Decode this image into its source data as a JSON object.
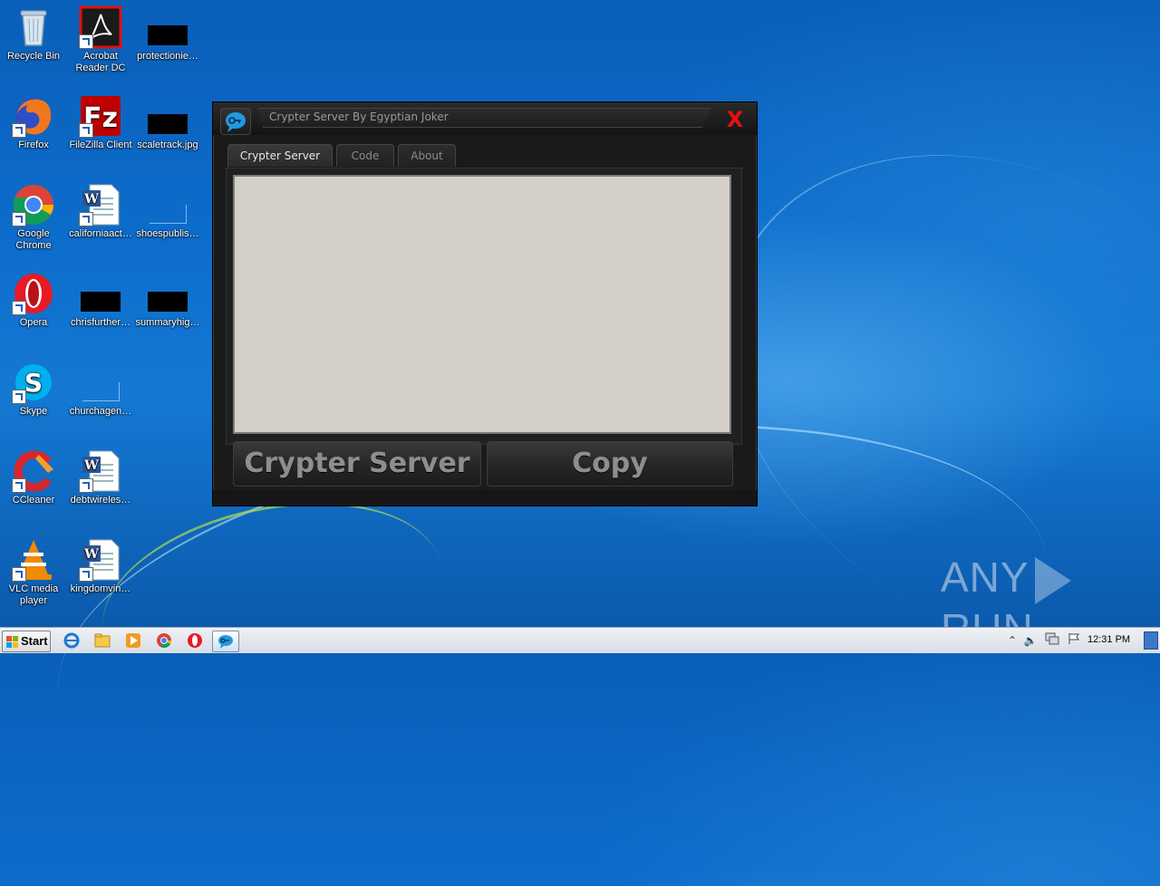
{
  "desktop": {
    "icons": [
      {
        "label": "Recycle Bin",
        "icon": "recycle-bin-icon"
      },
      {
        "label": "Acrobat Reader DC",
        "icon": "acrobat-reader-icon"
      },
      {
        "label": "protectionie…",
        "icon": "redacted-file-icon"
      },
      {
        "label": "Firefox",
        "icon": "firefox-icon"
      },
      {
        "label": "FileZilla Client",
        "icon": "filezilla-icon"
      },
      {
        "label": "scaletrack.jpg",
        "icon": "redacted-file-icon"
      },
      {
        "label": "Google Chrome",
        "icon": "chrome-icon"
      },
      {
        "label": "californiaact…",
        "icon": "word-document-icon"
      },
      {
        "label": "shoespublis…",
        "icon": "blank-file-icon"
      },
      {
        "label": "Opera",
        "icon": "opera-icon"
      },
      {
        "label": "chrisfurther…",
        "icon": "redacted-file-icon"
      },
      {
        "label": "summaryhig…",
        "icon": "redacted-file-icon"
      },
      {
        "label": "Skype",
        "icon": "skype-icon"
      },
      {
        "label": "churchagen…",
        "icon": "blank-file-icon"
      },
      {
        "label": "CCleaner",
        "icon": "ccleaner-icon"
      },
      {
        "label": "debtwireles…",
        "icon": "word-document-icon"
      },
      {
        "label": "VLC media player",
        "icon": "vlc-icon"
      },
      {
        "label": "kingdomvin…",
        "icon": "word-document-icon"
      }
    ]
  },
  "app": {
    "title": "Crypter Server By Egyptian Joker",
    "close_label": "X",
    "tabs": [
      {
        "label": "Crypter Server",
        "active": true
      },
      {
        "label": "Code",
        "active": false
      },
      {
        "label": "About",
        "active": false
      }
    ],
    "textarea_value": "",
    "buttons": {
      "crypter": "Crypter Server",
      "copy": "Copy"
    }
  },
  "watermark": {
    "left": "ANY",
    "right": "RUN"
  },
  "taskbar": {
    "start_label": "Start",
    "pinned": [
      "internet-explorer-icon",
      "file-explorer-icon",
      "media-player-icon",
      "chrome-icon",
      "opera-icon",
      "crypter-app-icon"
    ],
    "clock": "12:31 PM"
  },
  "colors": {
    "close_red": "#e81010",
    "textarea_bg": "#d4d0c8",
    "window_bg": "#1a1a1a"
  }
}
